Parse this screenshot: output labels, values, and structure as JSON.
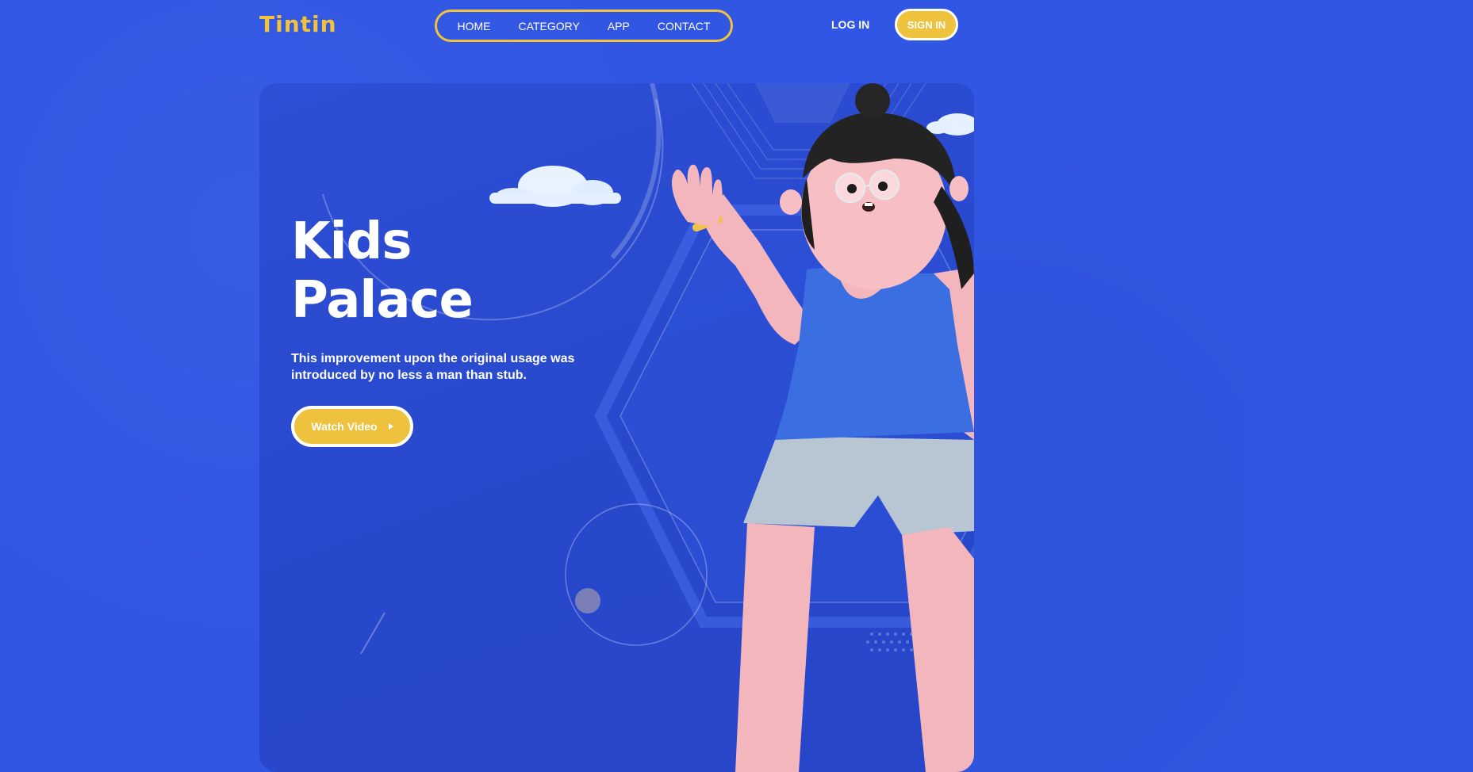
{
  "brand": {
    "name": "Tintin",
    "color": "#f2c23a"
  },
  "nav": {
    "items": [
      {
        "label": "HOME"
      },
      {
        "label": "CATEGORY"
      },
      {
        "label": "APP"
      },
      {
        "label": "CONTACT"
      }
    ]
  },
  "auth": {
    "login_label": "LOG IN",
    "signin_label": "SIGN IN"
  },
  "hero": {
    "title_line1": "Kids",
    "title_line2": "Palace",
    "description": "This improvement upon the original usage was introduced by no less a man than stub.",
    "cta_label": "Watch Video",
    "cta_icon": "play-icon"
  },
  "colors": {
    "background": "#3156e3",
    "card": "#2a4bd0",
    "accent": "#eec23c",
    "text": "#ffffff"
  }
}
